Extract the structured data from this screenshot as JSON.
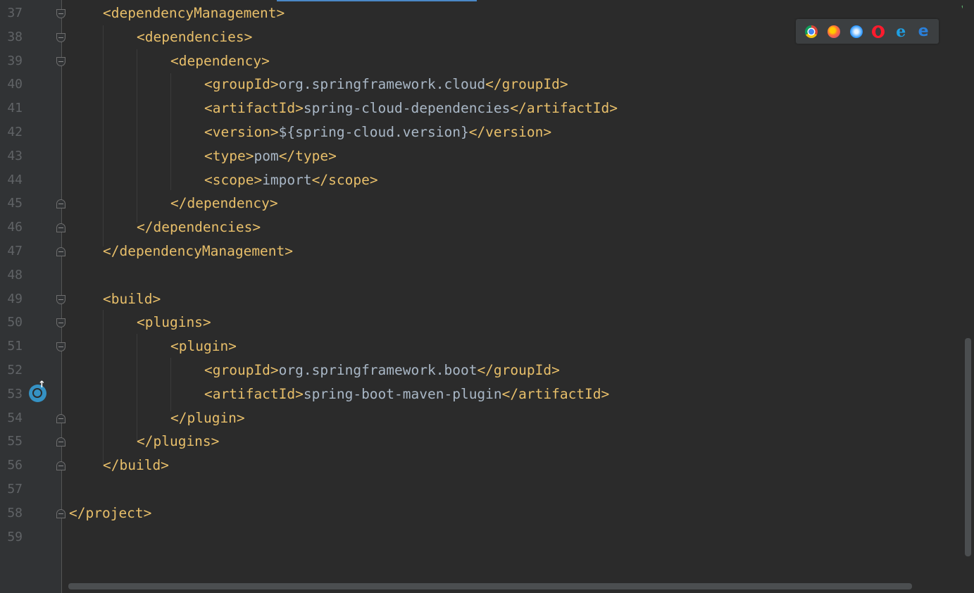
{
  "editor": {
    "line_numbers": [
      "37",
      "38",
      "39",
      "40",
      "41",
      "42",
      "43",
      "44",
      "45",
      "46",
      "47",
      "48",
      "49",
      "50",
      "51",
      "52",
      "53",
      "54",
      "55",
      "56",
      "57",
      "58",
      "59"
    ],
    "lines": [
      {
        "num": "37",
        "parts": [
          [
            "tag",
            "<dependencyManagement>"
          ]
        ]
      },
      {
        "num": "38",
        "parts": [
          [
            "tag",
            "<dependencies>"
          ]
        ]
      },
      {
        "num": "39",
        "parts": [
          [
            "tag",
            "<dependency>"
          ]
        ]
      },
      {
        "num": "40",
        "parts": [
          [
            "tag",
            "<groupId>"
          ],
          [
            "txt",
            "org.springframework.cloud"
          ],
          [
            "tag",
            "</groupId>"
          ]
        ]
      },
      {
        "num": "41",
        "parts": [
          [
            "tag",
            "<artifactId>"
          ],
          [
            "txt",
            "spring-cloud-dependencies"
          ],
          [
            "tag",
            "</artifactId>"
          ]
        ]
      },
      {
        "num": "42",
        "parts": [
          [
            "tag",
            "<version>"
          ],
          [
            "txt",
            "${spring-cloud.version}"
          ],
          [
            "tag",
            "</version>"
          ]
        ]
      },
      {
        "num": "43",
        "parts": [
          [
            "tag",
            "<type>"
          ],
          [
            "txt",
            "pom"
          ],
          [
            "tag",
            "</type>"
          ]
        ]
      },
      {
        "num": "44",
        "parts": [
          [
            "tag",
            "<scope>"
          ],
          [
            "txt",
            "import"
          ],
          [
            "tag",
            "</scope>"
          ]
        ]
      },
      {
        "num": "45",
        "parts": [
          [
            "tag",
            "</dependency>"
          ]
        ]
      },
      {
        "num": "46",
        "parts": [
          [
            "tag",
            "</dependencies>"
          ]
        ]
      },
      {
        "num": "47",
        "parts": [
          [
            "tag",
            "</dependencyManagement>"
          ]
        ]
      },
      {
        "num": "48",
        "parts": []
      },
      {
        "num": "49",
        "parts": [
          [
            "tag",
            "<build>"
          ]
        ]
      },
      {
        "num": "50",
        "parts": [
          [
            "tag",
            "<plugins>"
          ]
        ]
      },
      {
        "num": "51",
        "parts": [
          [
            "tag",
            "<plugin>"
          ]
        ]
      },
      {
        "num": "52",
        "parts": [
          [
            "tag",
            "<groupId>"
          ],
          [
            "txt",
            "org.springframework.boot"
          ],
          [
            "tag",
            "</groupId>"
          ]
        ]
      },
      {
        "num": "53",
        "parts": [
          [
            "tag",
            "<artifactId>"
          ],
          [
            "txt",
            "spring-boot-maven-plugin"
          ],
          [
            "tag",
            "</artifactId>"
          ]
        ]
      },
      {
        "num": "54",
        "parts": [
          [
            "tag",
            "</plugin>"
          ]
        ]
      },
      {
        "num": "55",
        "parts": [
          [
            "tag",
            "</plugins>"
          ]
        ]
      },
      {
        "num": "56",
        "parts": [
          [
            "tag",
            "</build>"
          ]
        ]
      },
      {
        "num": "57",
        "parts": []
      },
      {
        "num": "58",
        "parts": [
          [
            "tag",
            "</project>"
          ]
        ]
      },
      {
        "num": "59",
        "parts": []
      }
    ]
  },
  "browser_bar": {
    "icons": [
      "chrome-icon",
      "firefox-icon",
      "safari-icon",
      "opera-icon",
      "internet-explorer-icon",
      "edge-icon"
    ]
  },
  "status": {
    "check_icon": "✔"
  },
  "colors": {
    "background": "#2b2b2b",
    "gutter": "#313335",
    "tag": "#e8bf6a",
    "text": "#a9b7c6",
    "line_number": "#606366"
  }
}
